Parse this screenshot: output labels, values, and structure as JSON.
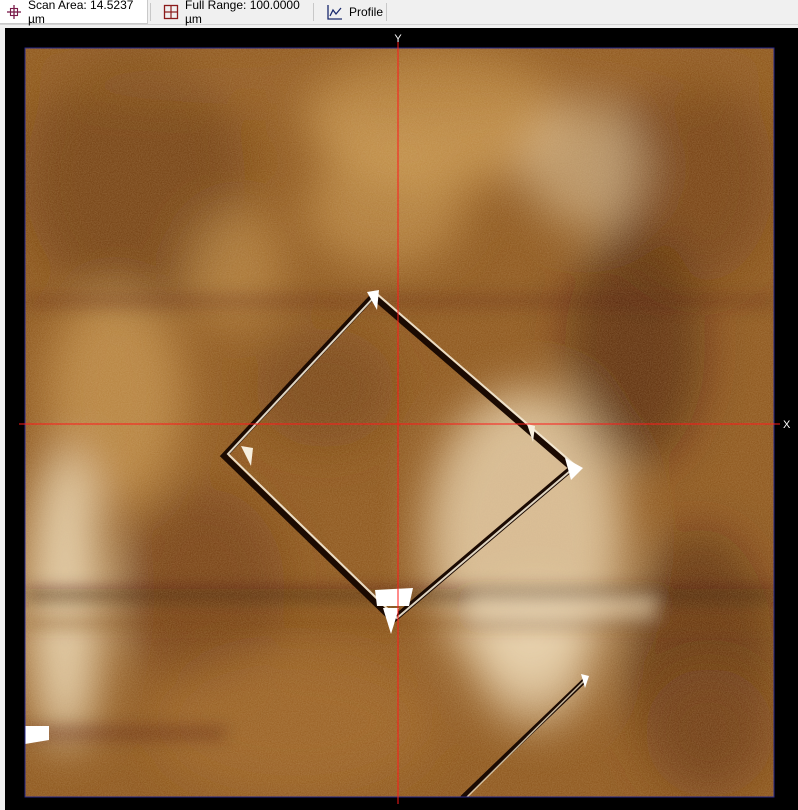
{
  "toolbar": {
    "scan_area_label": "Scan Area: 14.5237 µm",
    "full_range_label": "Full Range: 100.0000 µm",
    "profile_label": "Profile",
    "icons": [
      "scan-area-crosshair-icon",
      "full-range-grid-icon",
      "profile-chart-icon"
    ]
  },
  "image_view": {
    "y_axis_label": "Y",
    "x_axis_label": "X",
    "colormap": [
      "#3e1402",
      "#6e3a0a",
      "#9c6221",
      "#c9974f",
      "#f0dfbe"
    ],
    "crosshair_color": "#ff1a1a",
    "frame_color": "#2a2a8c"
  }
}
